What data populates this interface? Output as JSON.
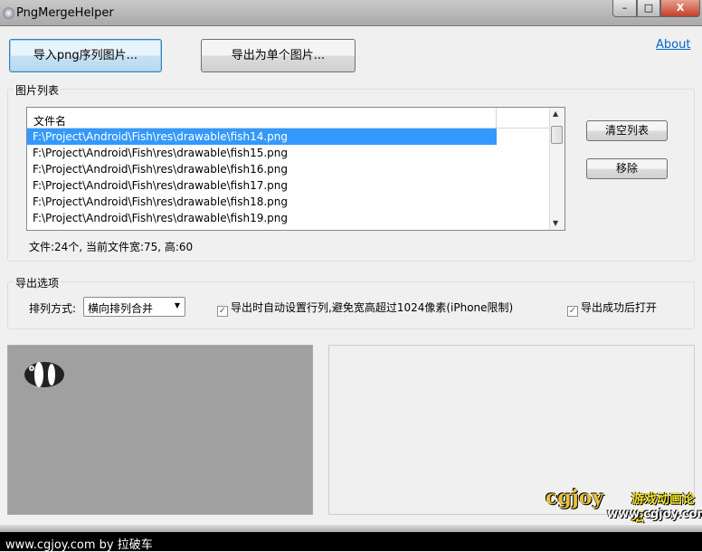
{
  "window": {
    "title": "PngMergeHelper",
    "minimize": "–",
    "maximize": "□",
    "close": "X"
  },
  "toolbar": {
    "import_label": "导入png序列图片...",
    "export_label": "导出为单个图片...",
    "about_link": "About"
  },
  "image_list": {
    "group_label": "图片列表",
    "column_header": "文件名",
    "rows": [
      "F:\\Project\\Android\\Fish\\res\\drawable\\fish14.png",
      "F:\\Project\\Android\\Fish\\res\\drawable\\fish15.png",
      "F:\\Project\\Android\\Fish\\res\\drawable\\fish16.png",
      "F:\\Project\\Android\\Fish\\res\\drawable\\fish17.png",
      "F:\\Project\\Android\\Fish\\res\\drawable\\fish18.png",
      "F:\\Project\\Android\\Fish\\res\\drawable\\fish19.png"
    ],
    "selected_index": 0,
    "clear_label": "清空列表",
    "remove_label": "移除",
    "status": "文件:24个, 当前文件宽:75, 高:60"
  },
  "export_options": {
    "group_label": "导出选项",
    "arrange_label": "排列方式:",
    "arrange_value": "横向排列合并",
    "auto_layout_label": "导出时自动设置行列,避免宽高超过1024像素(iPhone限制)",
    "auto_layout_checked": true,
    "open_after_label": "导出成功后打开",
    "open_after_checked": true
  },
  "watermark": {
    "logo": "cgjoy.com 游戏动画论坛",
    "url": "www.cgjoy.com"
  },
  "footer": {
    "text": "www.cgjoy.com by 拉破车"
  }
}
